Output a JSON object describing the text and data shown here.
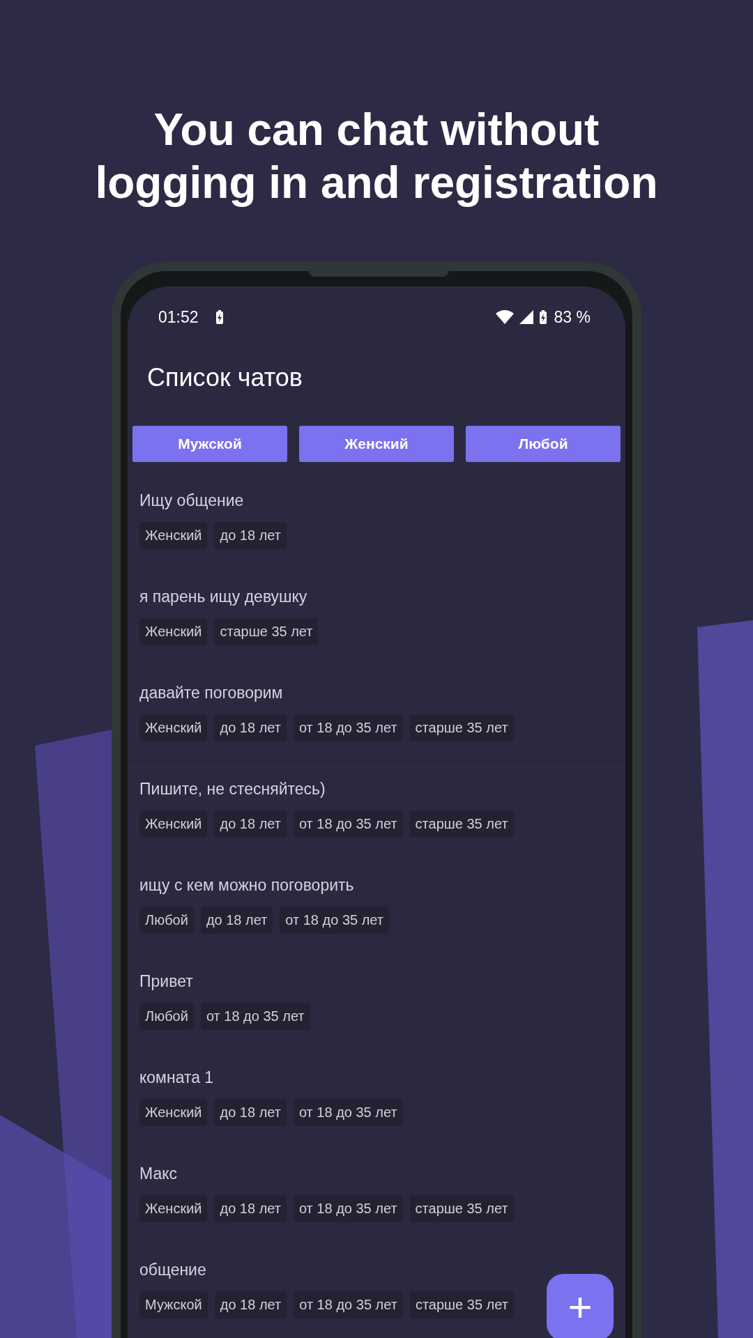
{
  "headline": "You can chat without logging in and registration",
  "status_bar": {
    "time": "01:52",
    "battery": "83 %"
  },
  "header": {
    "title": "Список чатов"
  },
  "filters": [
    {
      "label": "Мужской"
    },
    {
      "label": "Женский"
    },
    {
      "label": "Любой"
    }
  ],
  "chats": [
    {
      "title": "Ищу общение",
      "tags": [
        "Женский",
        "до 18 лет"
      ]
    },
    {
      "title": "я парень ищу девушку",
      "tags": [
        "Женский",
        "старше 35 лет"
      ]
    },
    {
      "title": "давайте поговорим",
      "tags": [
        "Женский",
        "до 18 лет",
        "от 18 до 35 лет",
        "старше 35 лет"
      ]
    },
    {
      "title": "Пишите, не стесняйтесь)",
      "tags": [
        "Женский",
        "до 18 лет",
        "от 18 до 35 лет",
        "старше 35 лет"
      ]
    },
    {
      "title": "ищу с кем можно поговорить",
      "tags": [
        "Любой",
        "до 18 лет",
        "от 18 до 35 лет"
      ]
    },
    {
      "title": "Привет",
      "tags": [
        "Любой",
        "от 18 до 35 лет"
      ]
    },
    {
      "title": "комната 1",
      "tags": [
        "Женский",
        "до 18 лет",
        "от 18 до 35 лет"
      ]
    },
    {
      "title": "Макс",
      "tags": [
        "Женский",
        "до 18 лет",
        "от 18 до 35 лет",
        "старше 35 лет"
      ]
    },
    {
      "title": "общение",
      "tags": [
        "Мужской",
        "до 18 лет",
        "от 18 до 35 лет",
        "старше 35 лет"
      ]
    }
  ],
  "fab": {
    "icon": "+"
  }
}
